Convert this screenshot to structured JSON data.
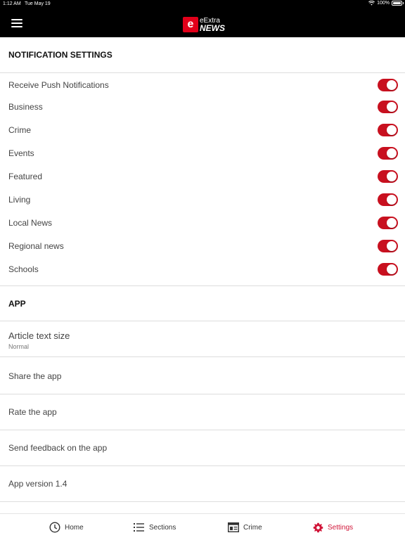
{
  "status_bar": {
    "time": "1:12 AM",
    "date": "Tue May 19",
    "battery": "100%",
    "battery_level": 1.0
  },
  "header": {
    "logo_mark": "e",
    "logo_line1": "eExtra",
    "logo_line2": "NEWS"
  },
  "notifications": {
    "title": "NOTIFICATION SETTINGS",
    "items": [
      {
        "label": "Receive Push Notifications",
        "on": true
      },
      {
        "label": "Business",
        "on": true
      },
      {
        "label": "Crime",
        "on": true
      },
      {
        "label": "Events",
        "on": true
      },
      {
        "label": "Featured",
        "on": true
      },
      {
        "label": "Living",
        "on": true
      },
      {
        "label": "Local News",
        "on": true
      },
      {
        "label": "Regional news",
        "on": true
      },
      {
        "label": "Schools",
        "on": true
      }
    ]
  },
  "app": {
    "title": "APP",
    "text_size_label": "Article text size",
    "text_size_value": "Normal",
    "share_label": "Share the app",
    "rate_label": "Rate the app",
    "feedback_label": "Send feedback on the app",
    "version_label": "App version 1.4"
  },
  "tabbar": {
    "home": "Home",
    "sections": "Sections",
    "crime": "Crime",
    "settings": "Settings",
    "active": "settings"
  },
  "colors": {
    "accent": "#d1173a",
    "toggle_on": "#c8101f",
    "header_bg": "#000000"
  }
}
